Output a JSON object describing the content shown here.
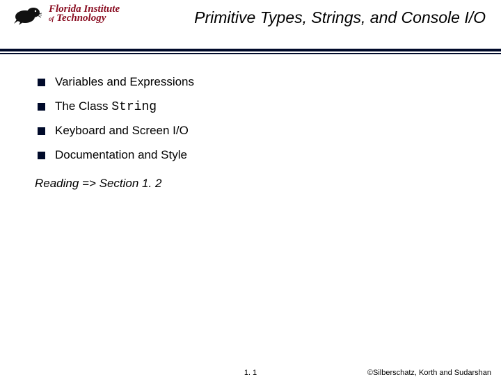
{
  "logo": {
    "line1": "Florida Institute",
    "line2_of": "of",
    "line2_rest": " Technology"
  },
  "title": "Primitive Types, Strings, and Console I/O",
  "bullets": [
    {
      "text": "Variables and Expressions",
      "code": ""
    },
    {
      "text": "The Class ",
      "code": "String"
    },
    {
      "text": "Keyboard and Screen I/O",
      "code": ""
    },
    {
      "text": "Documentation and Style",
      "code": ""
    }
  ],
  "reading": "Reading => Section 1. 2",
  "footer": {
    "page": "1. 1",
    "copyright": "©Silberschatz, Korth and Sudarshan"
  }
}
